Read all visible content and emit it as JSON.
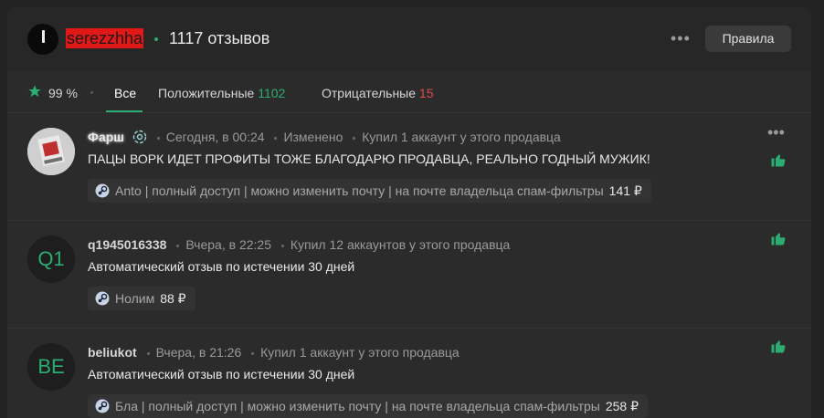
{
  "header": {
    "seller_name": "serezzhha",
    "reviews_count": "1117 отзывов",
    "rules_label": "Правила",
    "more": "•••"
  },
  "tabs": {
    "rating": "99 %",
    "all": "Все",
    "positive_label": "Положительные",
    "positive_count": "1102",
    "negative_label": "Отрицательные",
    "negative_count": "15"
  },
  "colors": {
    "accent": "#2bad72",
    "negative": "#e04b4b",
    "seller_highlight": "#e01818"
  },
  "reviews": [
    {
      "user": "Фарш",
      "time": "Сегодня, в 00:24",
      "edited": "Изменено",
      "bought": "Купил 1 аккаунт у этого продавца",
      "text": "ПАЦЫ ВОРК ИДЕТ ПРОФИТЫ ТОЖЕ БЛАГОДАРЮ ПРОДАВЦА, РЕАЛЬНО ГОДНЫЙ МУЖИК!",
      "tag": "Anto | полный доступ | можно изменить почту | на почте владельца спам-фильтры",
      "price": "141 ₽",
      "more": "•••"
    },
    {
      "avatar": "Q1",
      "user": "q1945016338",
      "time": "Вчера, в 22:25",
      "bought": "Купил 12 аккаунтов у этого продавца",
      "text": "Автоматический отзыв по истечении 30 дней",
      "tag": "Нолим",
      "price": "88 ₽"
    },
    {
      "avatar": "BE",
      "user": "beliukot",
      "time": "Вчера, в 21:26",
      "bought": "Купил 1 аккаунт у этого продавца",
      "text": "Автоматический отзыв по истечении 30 дней",
      "tag": "Бла | полный доступ | можно изменить почту | на почте владельца спам-фильтры",
      "price": "258 ₽"
    }
  ]
}
